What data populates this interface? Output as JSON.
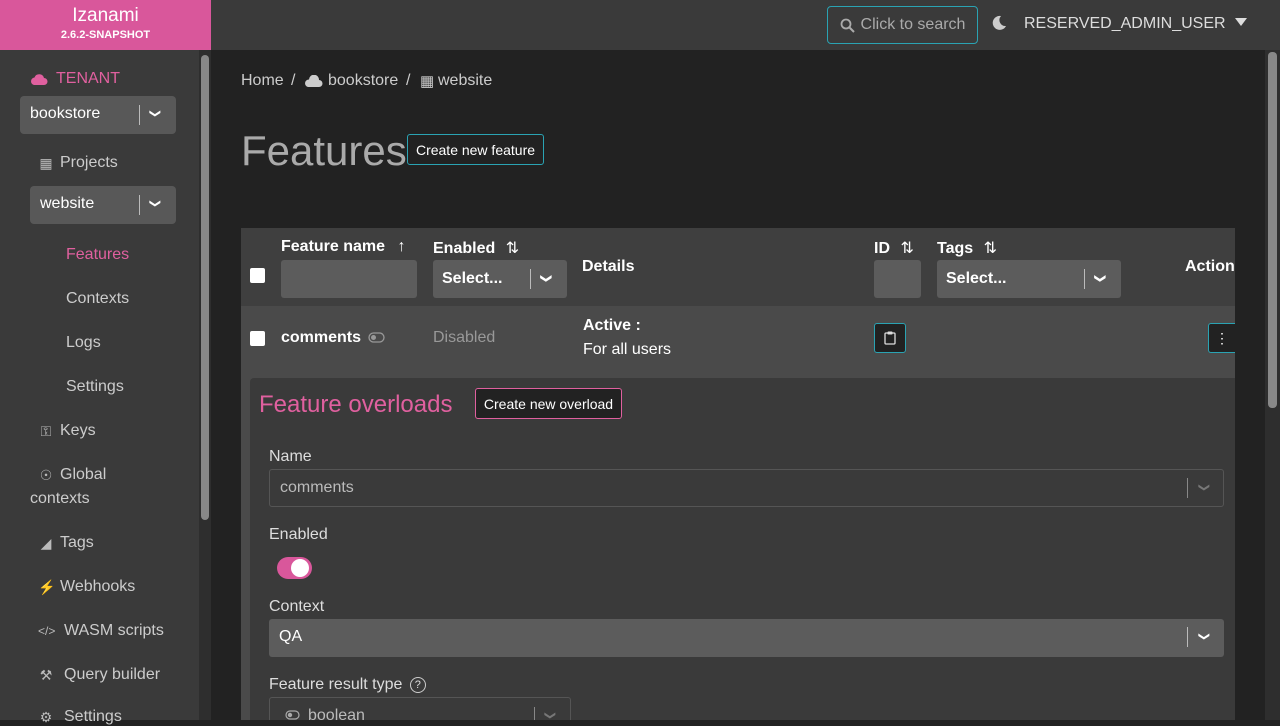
{
  "app": {
    "name": "Izanami",
    "version": "2.6.2-SNAPSHOT"
  },
  "sidebar": {
    "tenant_label": "TENANT",
    "tenant_selected": "bookstore",
    "projects_label": "Projects",
    "project_selected": "website",
    "project_items": [
      {
        "label": "Features",
        "active": true
      },
      {
        "label": "Contexts"
      },
      {
        "label": "Logs"
      },
      {
        "label": "Settings"
      }
    ],
    "items": [
      {
        "label": "Keys",
        "icon": "key-icon"
      },
      {
        "label": "Global",
        "label2": "contexts",
        "icon": "globe-icon"
      },
      {
        "label": "Tags",
        "icon": "tag-icon"
      },
      {
        "label": "Webhooks",
        "icon": "plug-icon"
      },
      {
        "label": "WASM scripts",
        "icon": "code-icon"
      },
      {
        "label": "Query builder",
        "icon": "hammer-icon"
      },
      {
        "label": "Settings",
        "icon": "gear-icon"
      }
    ]
  },
  "topbar": {
    "search_label": "Click to search",
    "user": "RESERVED_ADMIN_USER"
  },
  "breadcrumb": {
    "home": "Home",
    "sep": "/",
    "tenant": "bookstore",
    "project": "website"
  },
  "page": {
    "title": "Features",
    "create_button": "Create new feature"
  },
  "table": {
    "headers": {
      "name": "Feature name",
      "enabled": "Enabled",
      "details": "Details",
      "id": "ID",
      "tags": "Tags",
      "actions": "Action"
    },
    "filter_placeholder": "Select...",
    "rows": [
      {
        "name": "comments",
        "status": "Disabled",
        "details_title": "Active :",
        "details_value": "For all users"
      }
    ]
  },
  "overload": {
    "title": "Feature overloads",
    "create_button": "Create new overload",
    "name_label": "Name",
    "name_value": "comments",
    "enabled_label": "Enabled",
    "enabled_value": true,
    "context_label": "Context",
    "context_value": "QA",
    "result_type_label": "Feature result type",
    "result_type_value": "boolean"
  },
  "colors": {
    "accent": "#d9579b",
    "cyan": "#2aa3b3",
    "pink_text": "#e0609f"
  }
}
